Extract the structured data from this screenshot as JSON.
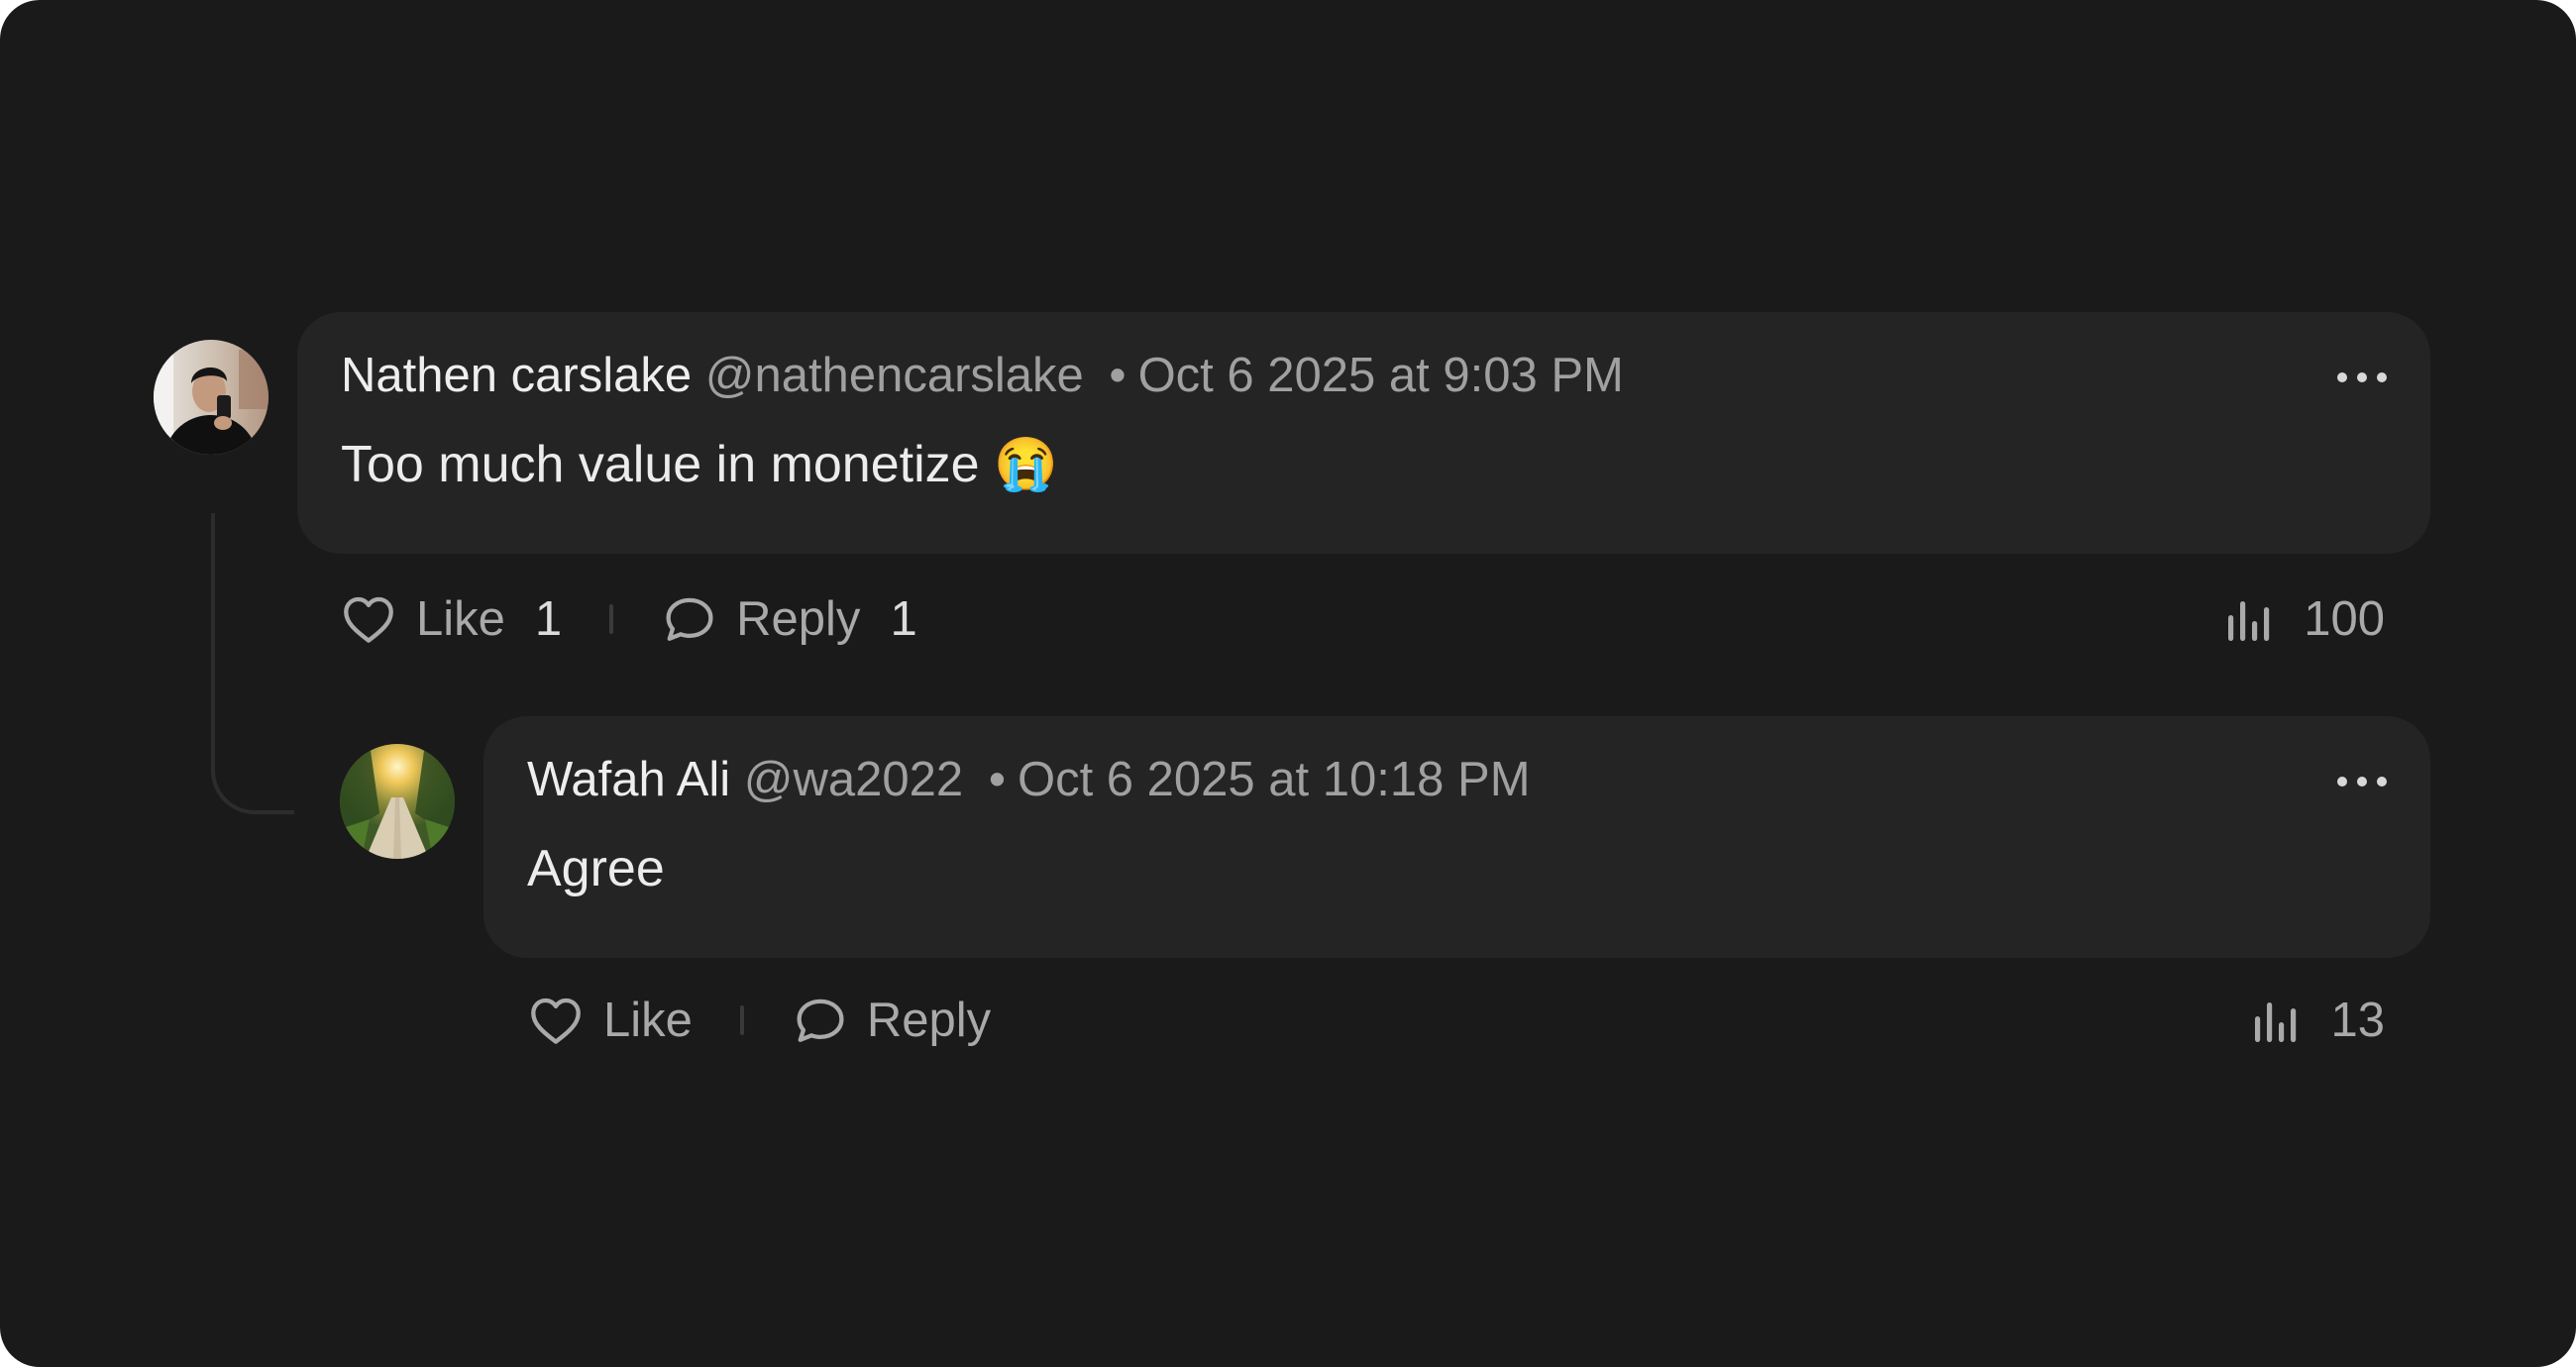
{
  "comments": [
    {
      "author": "Nathen carslake",
      "handle": "@nathencarslake",
      "separator": "•",
      "timestamp": "Oct 6 2025 at 9:03 PM",
      "text": "Too much value in monetize 😭",
      "like_label": "Like",
      "like_count": "1",
      "reply_label": "Reply",
      "reply_count": "1",
      "views": "100",
      "avatar_icon": "person-selfie-avatar"
    },
    {
      "author": "Wafah Ali",
      "handle": "@wa2022",
      "separator": "•",
      "timestamp": "Oct 6 2025 at 10:18 PM",
      "text": "Agree",
      "like_label": "Like",
      "reply_label": "Reply",
      "views": "13",
      "avatar_icon": "forest-path-avatar"
    }
  ],
  "colors": {
    "background": "#1a1a1a",
    "bubble": "#242424",
    "thread_line": "#2c2c2c",
    "primary_text": "#eeeeee",
    "secondary_text": "#a0a0a0"
  },
  "icons": [
    "heart-icon",
    "speech-bubble-icon",
    "bar-chart-icon",
    "more-dots-icon"
  ]
}
